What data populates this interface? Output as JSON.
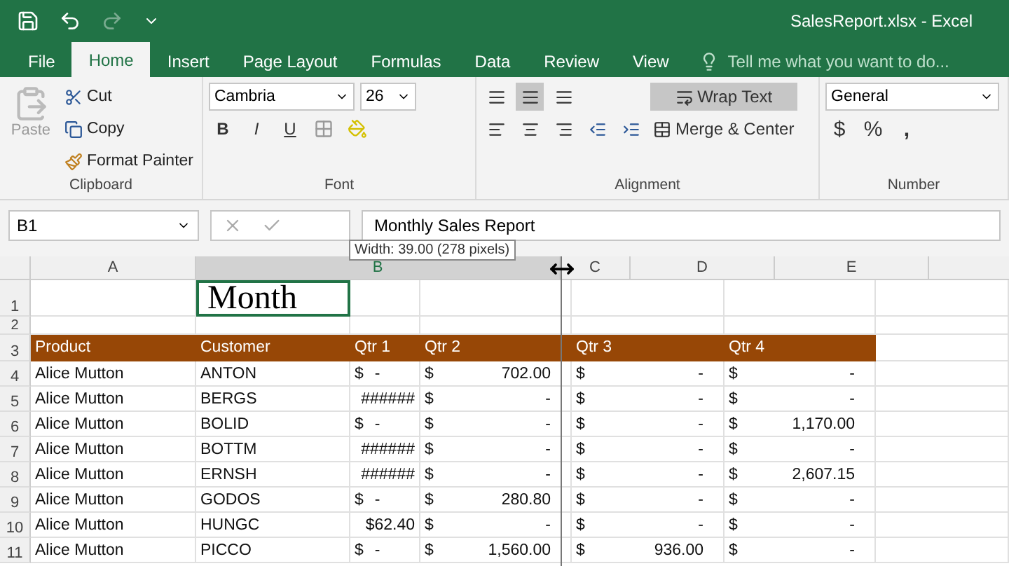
{
  "window": {
    "title": "SalesReport.xlsx - Excel"
  },
  "tabs": [
    {
      "label": "File",
      "selected": false
    },
    {
      "label": "Home",
      "selected": true
    },
    {
      "label": "Insert",
      "selected": false
    },
    {
      "label": "Page Layout",
      "selected": false
    },
    {
      "label": "Formulas",
      "selected": false
    },
    {
      "label": "Data",
      "selected": false
    },
    {
      "label": "Review",
      "selected": false
    },
    {
      "label": "View",
      "selected": false
    }
  ],
  "tell_me": {
    "placeholder": "Tell me what you want to do..."
  },
  "ribbon": {
    "clipboard": {
      "paste": "Paste",
      "cut": "Cut",
      "copy": "Copy",
      "format_painter": "Format Painter",
      "label": "Clipboard"
    },
    "font": {
      "name": "Cambria",
      "size": "26",
      "bold": "B",
      "italic": "I",
      "underline": "U",
      "label": "Font"
    },
    "alignment": {
      "vertical": [
        {
          "selected": false
        },
        {
          "selected": true
        },
        {
          "selected": false
        }
      ],
      "wrap_text": {
        "label": "Wrap Text",
        "on": true
      },
      "merge": "Merge & Center",
      "label": "Alignment"
    },
    "number": {
      "format": "General",
      "currency": "$",
      "percent": "%",
      "comma": ",",
      "label": "Number"
    }
  },
  "formula_bar": {
    "name_box": "B1",
    "formula": "Monthly Sales Report"
  },
  "tooltip": "Width: 39.00 (278 pixels)",
  "sheet": {
    "columns": [
      {
        "label": "A",
        "selected": false
      },
      {
        "label": "B",
        "selected": true
      },
      {
        "label": "C",
        "selected": false
      },
      {
        "label": "D",
        "selected": false
      },
      {
        "label": "E",
        "selected": false
      }
    ],
    "top_rows": [
      "1",
      "2",
      "3"
    ],
    "title_cell": "Month",
    "header": [
      "Product",
      "Customer",
      "Qtr 1",
      "Qtr 2",
      "Qtr 3",
      "Qtr 4"
    ],
    "rows": [
      {
        "num": "4",
        "product": "Alice Mutton",
        "customer": "ANTON",
        "q": [
          {
            "sign": "$",
            "value": "-"
          },
          {
            "sign": "$",
            "value": "702.00"
          },
          {
            "sign": "$",
            "value": "-"
          },
          {
            "sign": "$",
            "value": "-"
          }
        ]
      },
      {
        "num": "5",
        "product": "Alice Mutton",
        "customer": "BERGS",
        "q": [
          {
            "value": "######"
          },
          {
            "sign": "$",
            "value": "-"
          },
          {
            "sign": "$",
            "value": "-"
          },
          {
            "sign": "$",
            "value": "-"
          }
        ]
      },
      {
        "num": "6",
        "product": "Alice Mutton",
        "customer": "BOLID",
        "q": [
          {
            "sign": "$",
            "value": "-"
          },
          {
            "sign": "$",
            "value": "-"
          },
          {
            "sign": "$",
            "value": "-"
          },
          {
            "sign": "$",
            "value": "1,170.00"
          }
        ]
      },
      {
        "num": "7",
        "product": "Alice Mutton",
        "customer": "BOTTM",
        "q": [
          {
            "value": "######"
          },
          {
            "sign": "$",
            "value": "-"
          },
          {
            "sign": "$",
            "value": "-"
          },
          {
            "sign": "$",
            "value": "-"
          }
        ]
      },
      {
        "num": "8",
        "product": "Alice Mutton",
        "customer": "ERNSH",
        "q": [
          {
            "value": "######"
          },
          {
            "sign": "$",
            "value": "-"
          },
          {
            "sign": "$",
            "value": "-"
          },
          {
            "sign": "$",
            "value": "2,607.15"
          }
        ]
      },
      {
        "num": "9",
        "product": "Alice Mutton",
        "customer": "GODOS",
        "q": [
          {
            "sign": "$",
            "value": "-"
          },
          {
            "sign": "$",
            "value": "280.80"
          },
          {
            "sign": "$",
            "value": "-"
          },
          {
            "sign": "$",
            "value": "-"
          }
        ]
      },
      {
        "num": "10",
        "product": "Alice Mutton",
        "customer": "HUNGC",
        "q": [
          {
            "value": "$62.40"
          },
          {
            "sign": "$",
            "value": "-"
          },
          {
            "sign": "$",
            "value": "-"
          },
          {
            "sign": "$",
            "value": "-"
          }
        ]
      },
      {
        "num": "11",
        "product": "Alice Mutton",
        "customer": "PICCO",
        "q": [
          {
            "sign": "$",
            "value": "-"
          },
          {
            "sign": "$",
            "value": "1,560.00"
          },
          {
            "sign": "$",
            "value": "936.00"
          },
          {
            "sign": "$",
            "value": "-"
          }
        ]
      }
    ]
  }
}
